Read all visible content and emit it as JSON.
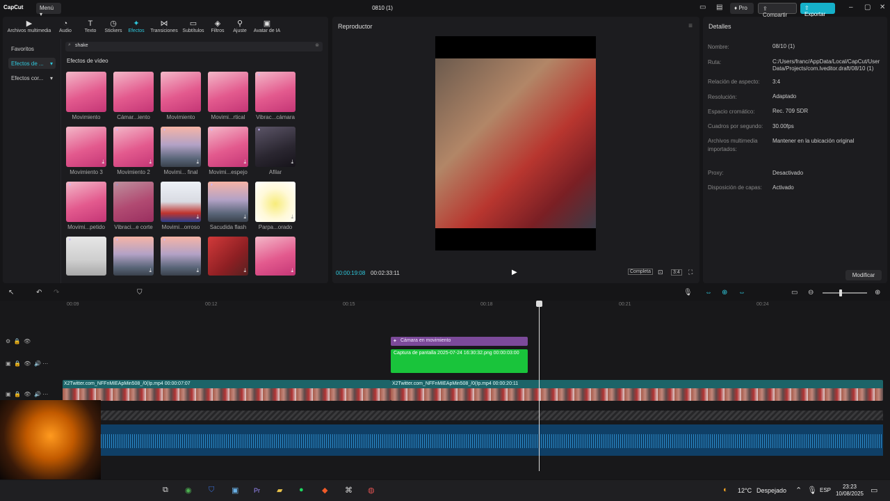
{
  "app": {
    "logo": "CapCut",
    "menu": "Menú",
    "project_title": "0810 (1)",
    "pro": "Pro",
    "share": "Compartir",
    "export": "Exportar"
  },
  "categories": [
    {
      "label": "Archivos multimedia",
      "icon": "media-icon"
    },
    {
      "label": "Audio",
      "icon": "audio-icon"
    },
    {
      "label": "Texto",
      "icon": "text-icon"
    },
    {
      "label": "Stickers",
      "icon": "sticker-icon"
    },
    {
      "label": "Efectos",
      "icon": "effects-icon"
    },
    {
      "label": "Transiciones",
      "icon": "transition-icon"
    },
    {
      "label": "Subtítulos",
      "icon": "subtitle-icon"
    },
    {
      "label": "Filtros",
      "icon": "filter-icon"
    },
    {
      "label": "Ajuste",
      "icon": "adjust-icon"
    },
    {
      "label": "Avatar de IA",
      "icon": "avatar-icon"
    }
  ],
  "subnav": [
    "Favoritos",
    "Efectos de ...",
    "Efectos cor..."
  ],
  "search": {
    "value": "shake"
  },
  "section_title": "Efectos de vídeo",
  "effects": [
    "Movimiento",
    "Cámar...iento",
    "Movimiento",
    "Movimi...rtical",
    "Vibrac...cámara",
    "Movimiento 3",
    "Movimiento 2",
    "Movimi... final",
    "Movimi...espejo",
    "Afilar",
    "Movimi...petido",
    "Vibraci...e corte",
    "Movimi...orroso",
    "Sacudida flash",
    "Parpa...orado",
    "",
    "",
    "",
    "",
    ""
  ],
  "player": {
    "title": "Reproductor",
    "time_current": "00:00:19:08",
    "time_total": "00:02:33:11",
    "ratio": "Completa",
    "aspect": "3:4"
  },
  "details": {
    "title": "Detalles",
    "rows": [
      {
        "k": "Nombre:",
        "v": "08/10 (1)"
      },
      {
        "k": "Ruta:",
        "v": "C:/Users/franc/AppData/Local/CapCut/User Data/Projects/com.lveditor.draft/08/10 (1)"
      },
      {
        "k": "Relación de aspecto:",
        "v": "3:4"
      },
      {
        "k": "Resolución:",
        "v": "Adaptado"
      },
      {
        "k": "Espacio cromático:",
        "v": "Rec. 709 SDR"
      },
      {
        "k": "Cuadros por segundo:",
        "v": "30.00fps"
      },
      {
        "k": "Archivos multimedia importados:",
        "v": "Mantener en la ubicación original"
      },
      {
        "k": "Proxy:",
        "v": "Desactivado"
      },
      {
        "k": "Disposición de capas:",
        "v": "Activado"
      }
    ],
    "modify": "Modificar"
  },
  "timeline": {
    "ticks": [
      "00:09",
      "00:12",
      "00:15",
      "00:18",
      "00:21",
      "00:24"
    ],
    "effect_clip": "Cámara en movimiento",
    "green_clip": "Captura de pantalla 2025-07-24 16:30:32.png  00:00:03:00",
    "main_clip_1": "X2Twitter.com_NFFnMIEApMin508_/0(Ip.mp4  00:00:07:07",
    "main_clip_2": "X2Twitter.com_NFFnMIEApMin508_/0(Ip.mp4  00:00:20:11"
  },
  "taskbar": {
    "temp": "12°C",
    "weather": "Despejado",
    "lang": "ESP",
    "time": "23:23",
    "date": "10/08/2025"
  }
}
